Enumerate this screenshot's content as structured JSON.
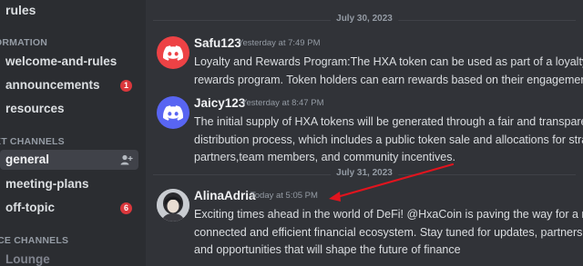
{
  "sidebar": {
    "top_channel": "rules",
    "categories": [
      "ORMATION",
      "XT CHANNELS",
      "ICE CHANNELS"
    ],
    "info_channels": [
      {
        "label": "welcome-and-rules"
      },
      {
        "label": "announcements",
        "badge": "1"
      },
      {
        "label": "resources"
      }
    ],
    "text_channels": [
      {
        "label": "general"
      },
      {
        "label": "meeting-plans"
      },
      {
        "label": "off-topic",
        "badge": "6"
      }
    ],
    "voice_channels": [
      {
        "label": "Lounge"
      }
    ]
  },
  "chat": {
    "dividers": [
      "July 30, 2023",
      "July 31, 2023"
    ],
    "messages": [
      {
        "author": "Safu123",
        "timestamp": "Yesterday at 7:49 PM",
        "avatar_color": "#ed4245",
        "lines": [
          "Loyalty and Rewards Program:The HXA token can be used as part of a loyalty and",
          "rewards program. Token holders can earn rewards based on their engagement."
        ]
      },
      {
        "author": "Jaicy123",
        "timestamp": "Yesterday at 8:47 PM",
        "avatar_color": "#5865f2",
        "lines": [
          "The initial supply of HXA tokens will be generated through a fair and transparent",
          "distribution process, which includes a public token sale and allocations for strategic",
          "partners,team members, and community incentives."
        ]
      },
      {
        "author": "AlinaAdria",
        "timestamp": "Today at 5:05 PM",
        "lines": [
          "Exciting times ahead in the world of DeFi! @HxaCoin is paving the way for a more",
          "connected and efficient financial ecosystem. Stay tuned for updates, partnerships,",
          "and opportunities that will shape the future of finance"
        ]
      }
    ]
  },
  "colors": {
    "annotation_arrow": "#e0141e"
  }
}
